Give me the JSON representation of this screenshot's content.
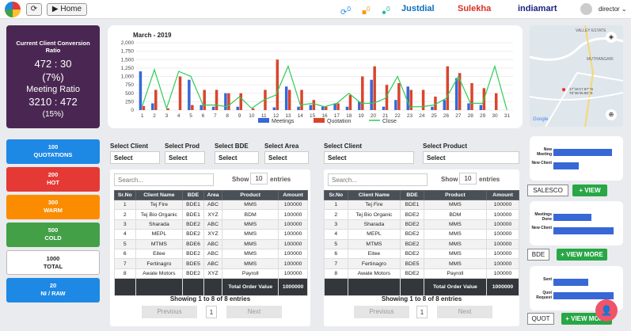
{
  "topbar": {
    "home": "Home",
    "badges": [
      "0",
      "0",
      "0"
    ],
    "brands": [
      "Justdial",
      "Sulekha",
      "indiamart"
    ],
    "user": "director"
  },
  "left_card": {
    "title": "Current Client Conversion Ratio",
    "ratio": "472 : 30",
    "pct": "(7%)",
    "meeting_title": "Meeting Ratio",
    "meeting_ratio": "3210 : 472",
    "meeting_pct": "(15%)"
  },
  "stats": [
    {
      "count": "100",
      "label": "QUOTATIONS",
      "color": "#1e88e5"
    },
    {
      "count": "200",
      "label": "HOT",
      "color": "#e53935"
    },
    {
      "count": "300",
      "label": "WARM",
      "color": "#fb8c00"
    },
    {
      "count": "500",
      "label": "COLD",
      "color": "#43a047"
    },
    {
      "count": "1000",
      "label": "TOTAL",
      "color": "#ffffff"
    },
    {
      "count": "20",
      "label": "NI / RAW",
      "color": "#1e88e5"
    }
  ],
  "chart_data": {
    "type": "bar",
    "title": "March - 2019",
    "categories": [
      "1",
      "2",
      "3",
      "4",
      "5",
      "6",
      "7",
      "8",
      "9",
      "10",
      "11",
      "12",
      "13",
      "14",
      "15",
      "16",
      "17",
      "18",
      "19",
      "20",
      "21",
      "22",
      "23",
      "24",
      "25",
      "26",
      "27",
      "28",
      "29",
      "30",
      "31"
    ],
    "ylim": [
      0,
      2000
    ],
    "yticks": [
      "0",
      "250",
      "500",
      "750",
      "1,000",
      "1,250",
      "1,500",
      "1,750",
      "2,000"
    ],
    "series": [
      {
        "name": "Meetings",
        "color": "#3867d6",
        "values": [
          1150,
          200,
          0,
          0,
          900,
          150,
          100,
          500,
          100,
          0,
          0,
          80,
          700,
          100,
          150,
          100,
          200,
          100,
          250,
          900,
          100,
          300,
          700,
          0,
          100,
          300,
          950,
          200,
          150,
          0,
          0
        ]
      },
      {
        "name": "Quotation",
        "color": "#d9452b",
        "values": [
          120,
          600,
          50,
          1000,
          150,
          600,
          600,
          500,
          500,
          50,
          600,
          1500,
          600,
          600,
          300,
          100,
          200,
          450,
          1000,
          1300,
          750,
          800,
          600,
          600,
          400,
          1300,
          1100,
          800,
          650,
          500,
          0
        ]
      },
      {
        "name": "Close",
        "color": "#2ecc55",
        "values": [
          120,
          1200,
          50,
          1150,
          1000,
          150,
          150,
          100,
          400,
          50,
          300,
          450,
          1300,
          150,
          200,
          100,
          200,
          500,
          200,
          200,
          350,
          1000,
          100,
          100,
          150,
          350,
          1000,
          200,
          200,
          1300,
          0
        ]
      }
    ]
  },
  "filters_left": {
    "client_label": "Select Client",
    "prod_label": "Select Prod",
    "bde_label": "Select BDE",
    "area_label": "Select Area",
    "client": "Select",
    "prod": "Select",
    "bde": "Select",
    "area": "Select"
  },
  "filters_right": {
    "client_label": "Select Client",
    "product_label": "Select Product",
    "client": "Select",
    "product": "Select"
  },
  "table": {
    "search_placeholder": "Search...",
    "show": "Show",
    "entries_val": "10",
    "entries": "entries",
    "headers_left": [
      "Sr.No",
      "Client Name",
      "BDE",
      "Area",
      "Product",
      "Amount"
    ],
    "headers_right": [
      "Sr.No",
      "Client Name",
      "BDE",
      "Product",
      "Amount"
    ],
    "rows_left": [
      [
        "1",
        "Tej Fire",
        "BDE1",
        "ABC",
        "MMS",
        "100000"
      ],
      [
        "2",
        "Tej Bio Organic",
        "BDE1",
        "XYZ",
        "BDM",
        "100000"
      ],
      [
        "3",
        "Sharada",
        "BDE2",
        "ABC",
        "MMS",
        "100000"
      ],
      [
        "4",
        "MEPL",
        "BDE2",
        "XYZ",
        "MMS",
        "100000"
      ],
      [
        "5",
        "MTMS",
        "BDE6",
        "ABC",
        "MMS",
        "100000"
      ],
      [
        "6",
        "Eitee",
        "BDE2",
        "ABC",
        "MMS",
        "100000"
      ],
      [
        "7",
        "Fertinagro",
        "BDE5",
        "ABC",
        "MMS",
        "100000"
      ],
      [
        "8",
        "Awate Motors",
        "BDE2",
        "XYZ",
        "Payroll",
        "100000"
      ]
    ],
    "rows_right": [
      [
        "1",
        "Tej Fire",
        "BDE1",
        "MMS",
        "100000"
      ],
      [
        "2",
        "Tej Bio Organic",
        "BDE2",
        "BDM",
        "100000"
      ],
      [
        "3",
        "Sharada",
        "BDE2",
        "MMS",
        "100000"
      ],
      [
        "4",
        "MEPL",
        "BDE2",
        "MMS",
        "100000"
      ],
      [
        "5",
        "MTMS",
        "BDE2",
        "MMS",
        "100000"
      ],
      [
        "6",
        "Eitee",
        "BDE2",
        "MMS",
        "100000"
      ],
      [
        "7",
        "Fertinagro",
        "BDE5",
        "MMS",
        "100000"
      ],
      [
        "8",
        "Awate Motors",
        "BDE2",
        "Payroll",
        "100000"
      ]
    ],
    "total_label": "Total Order Value",
    "total": "1000000",
    "showing": "Showing 1 to 8 of 8 entries",
    "prev": "Previous",
    "page": "1",
    "next": "Next"
  },
  "mini": [
    {
      "labels": [
        "New Meeting",
        "New Client"
      ],
      "values": [
        0.92,
        0.4
      ],
      "btn_outline": "SALESCO",
      "btn_green": "+ VIEW"
    },
    {
      "labels": [
        "Meetings Done",
        "New Client"
      ],
      "values": [
        0.6,
        0.95
      ],
      "btn_outline": "BDE",
      "btn_green": "+ VIEW MORE"
    },
    {
      "labels": [
        "Sent",
        "Quot Request"
      ],
      "values": [
        0.55,
        0.95
      ],
      "btn_outline": "QUOT",
      "btn_green": "+ VIEW MORE"
    }
  ],
  "map": {
    "labels": [
      "VALLEY ESTATE",
      "MUTHANGARI",
      "Google"
    ],
    "coord": "17°16'17.87\" N 78°46'46.85\" E"
  }
}
